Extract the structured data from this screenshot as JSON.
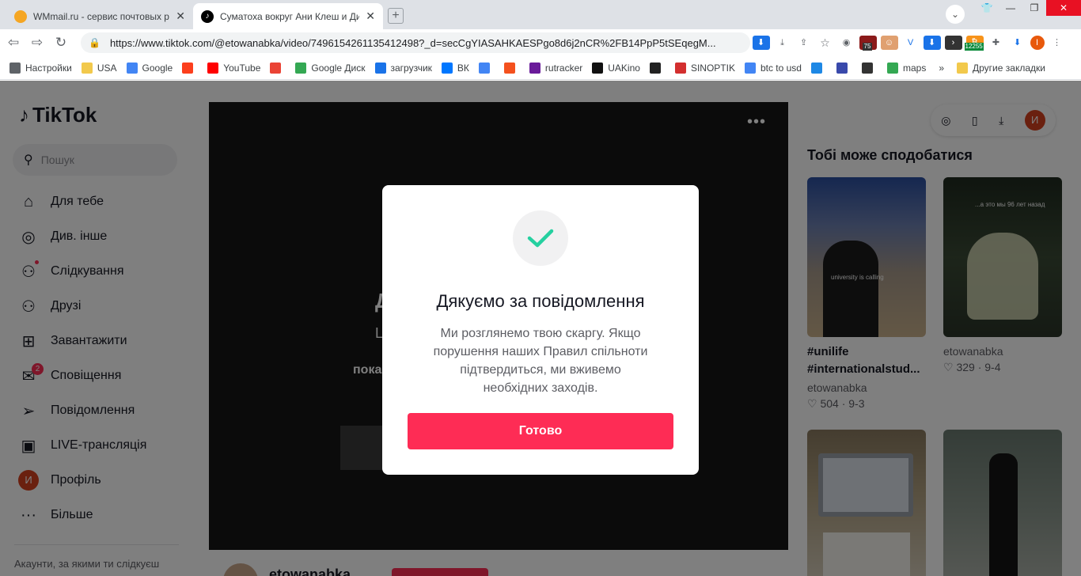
{
  "browser": {
    "tabs": [
      {
        "title": "WMmail.ru - сервис почтовых рас",
        "active": false
      },
      {
        "title": "Суматоха вокруг Ани Клеш и Ди",
        "active": true
      }
    ],
    "close_glyph": "✕",
    "new_tab_glyph": "+",
    "url": "https://www.tiktok.com/@etowanabka/video/7496154261135412498?_d=secCgYIASAHKAESPgo8d6j2nCR%2FB14PpP5tSEqegM...",
    "extension_badges": {
      "counter": "75",
      "price": "12255",
      "profile_initial": "I"
    },
    "bookmarks": [
      {
        "label": "Настройки",
        "icon": "gear-icon"
      },
      {
        "label": "USA",
        "icon": "folder-icon"
      },
      {
        "label": "Google",
        "icon": "google-icon"
      },
      {
        "label": "",
        "icon": "yandex-icon"
      },
      {
        "label": "YouTube",
        "icon": "youtube-icon"
      },
      {
        "label": "",
        "icon": "gmail-icon"
      },
      {
        "label": "Google Диск",
        "icon": "drive-icon"
      },
      {
        "label": "загрузчик",
        "icon": "loader-icon"
      },
      {
        "label": "ВК",
        "icon": "vk-icon"
      },
      {
        "label": "",
        "icon": "translate-icon"
      },
      {
        "label": "",
        "icon": "f-icon"
      },
      {
        "label": "rutracker",
        "icon": "rutracker-icon"
      },
      {
        "label": "UAKino",
        "icon": "uakino-icon"
      },
      {
        "label": "",
        "icon": "person-icon"
      },
      {
        "label": "SINOPTIK",
        "icon": "thermometer-icon"
      },
      {
        "label": "btc to usd",
        "icon": "google-icon"
      },
      {
        "label": "",
        "icon": "p-icon"
      },
      {
        "label": "",
        "icon": "chevron-icon"
      },
      {
        "label": "",
        "icon": "bc-icon"
      },
      {
        "label": "maps",
        "icon": "maps-icon"
      }
    ],
    "bookmarks_more": "»",
    "other_bookmarks": "Другие закладки"
  },
  "tiktok": {
    "logo": "TikTok",
    "search_placeholder": "Пошук",
    "nav": [
      {
        "label": "Для тебе",
        "icon": "home-icon"
      },
      {
        "label": "Див. інше",
        "icon": "compass-icon"
      },
      {
        "label": "Слідкування",
        "icon": "following-icon"
      },
      {
        "label": "Друзі",
        "icon": "friends-icon"
      },
      {
        "label": "Завантажити",
        "icon": "upload-icon"
      },
      {
        "label": "Сповіщення",
        "icon": "notification-icon",
        "badge": "2"
      },
      {
        "label": "Повідомлення",
        "icon": "send-icon"
      },
      {
        "label": "LIVE-трансляція",
        "icon": "live-icon"
      },
      {
        "label": "Профіль",
        "icon": "avatar",
        "avatar_initial": "И"
      },
      {
        "label": "Більше",
        "icon": "more-icon"
      }
    ],
    "following_accounts": "Акаунти, за якими ти слідкуєш",
    "video": {
      "more_glyph": "•••",
      "partial_title": "Д",
      "partial_line1": "L",
      "partial_line2": "пока"
    },
    "author": {
      "name": "etowanabka"
    },
    "recommend_title": "Тобі може сподобатися",
    "recommendations": [
      {
        "caption": "#unilife #internationalstud...",
        "author": "etowanabka",
        "likes": "504",
        "date": "9-3",
        "overlay": "university is calling"
      },
      {
        "caption": "",
        "author": "etowanabka",
        "likes": "329",
        "date": "9-4",
        "overlay": "...а это мы 96 лет назад"
      },
      {
        "caption": "",
        "author": "",
        "likes": "",
        "date": "",
        "overlay": ""
      },
      {
        "caption": "",
        "author": "",
        "likes": "",
        "date": "",
        "overlay": ""
      }
    ],
    "stat_separator": "·",
    "profile_initial": "И"
  },
  "modal": {
    "title": "Дякуємо за повідомлення",
    "body": "Ми розглянемо твою скаргу. Якщо порушення наших Правил спільноти підтвердиться, ми вживемо необхідних заходів.",
    "button": "Готово",
    "check_color": "#25d0a0",
    "button_color": "#fe2c55"
  }
}
